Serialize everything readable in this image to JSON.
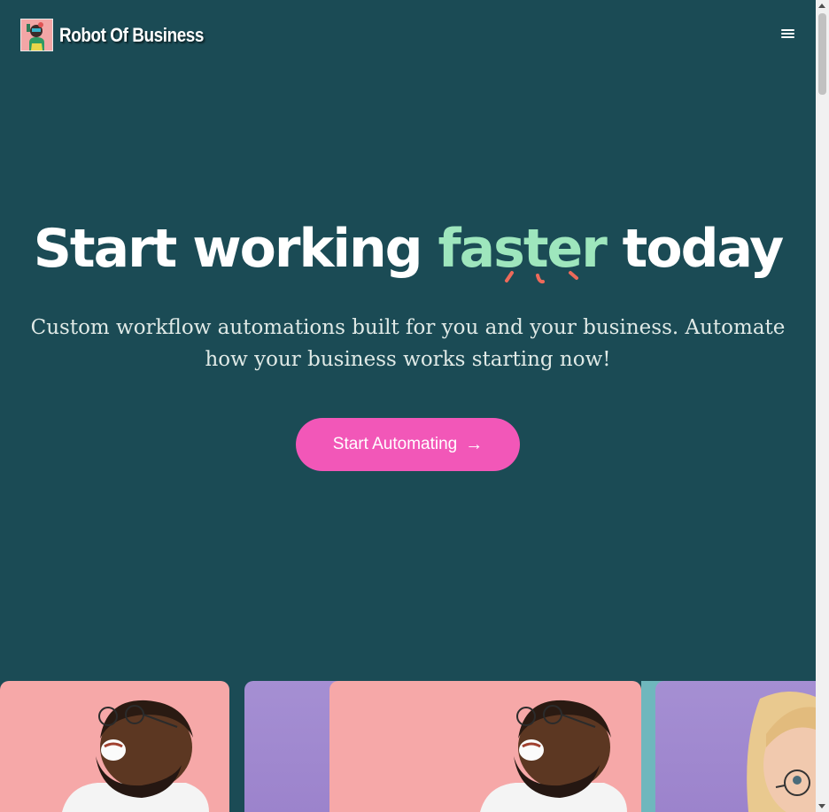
{
  "header": {
    "brand": "Robot Of Business",
    "logo_icon": "robot-portrait-icon",
    "menu_icon": "hamburger-menu-icon"
  },
  "hero": {
    "title_before": "Start working ",
    "title_highlight": "faster",
    "title_after": " today",
    "subtitle": "Custom workflow automations built for you and your business. Automate how your business works starting now!",
    "cta_label": "Start Automating",
    "cta_icon": "arrow-right-icon"
  },
  "colors": {
    "background": "#1b4b55",
    "highlight": "#9ee6bd",
    "accent_marks": "#ee6a5a",
    "cta": "#f257b8"
  },
  "gallery": {
    "cards": [
      {
        "subject": "laughing-man-photo",
        "background": "pink"
      },
      {
        "subject": "purple-backdrop-photo",
        "background": "purple"
      },
      {
        "subject": "laughing-man-photo",
        "background": "pink"
      },
      {
        "subject": "woman-with-glasses-photo",
        "background": "purple"
      }
    ]
  }
}
